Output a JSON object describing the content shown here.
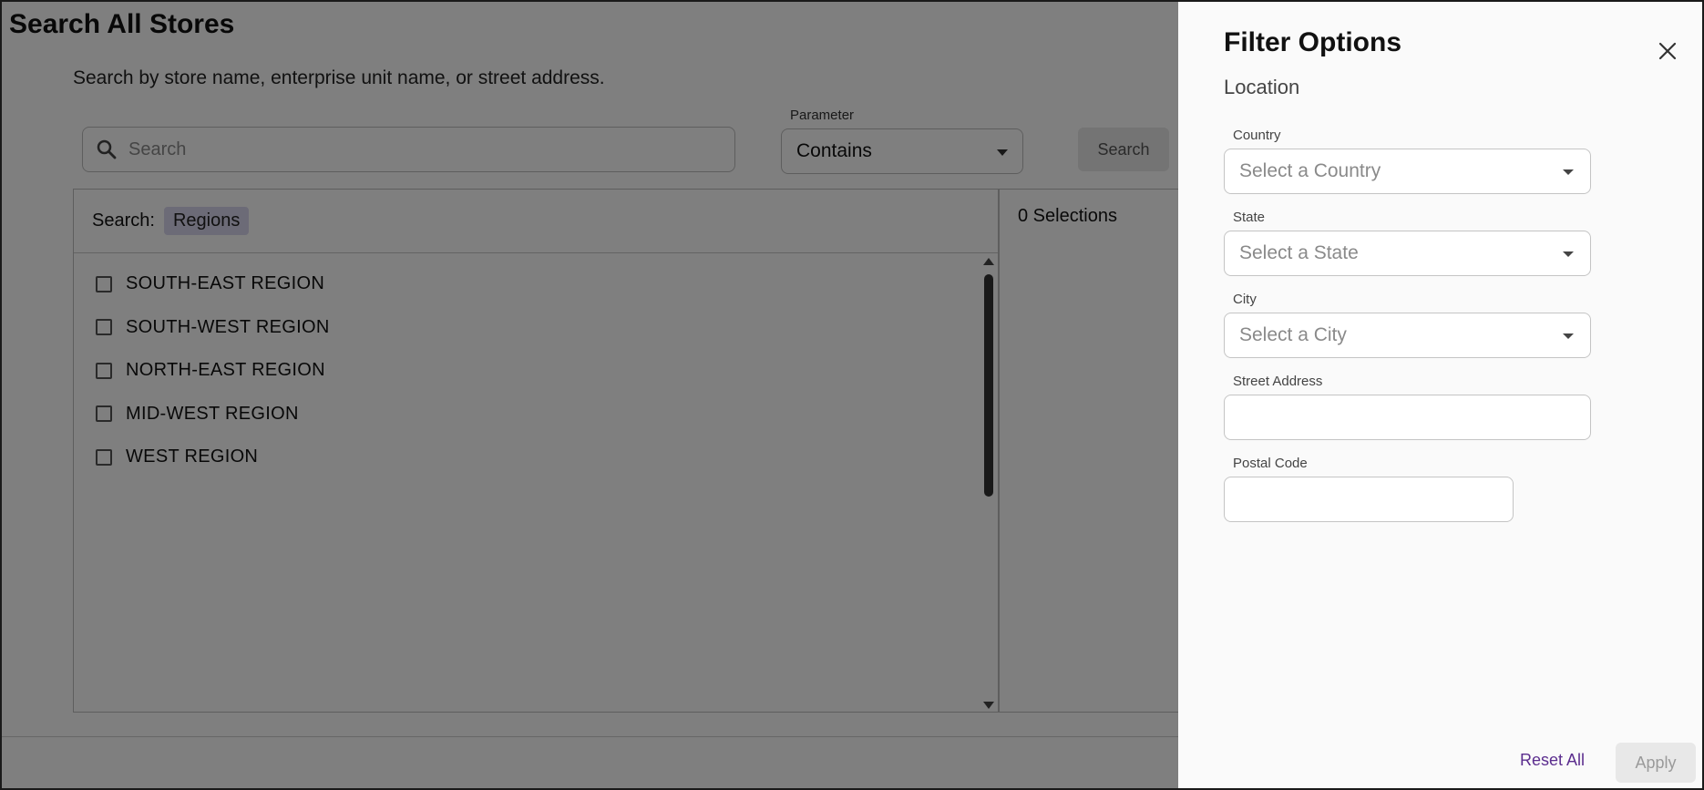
{
  "page": {
    "title": "Search All Stores",
    "subtitle": "Search by store name, enterprise unit name, or street address."
  },
  "search": {
    "placeholder": "Search",
    "parameter_label": "Parameter",
    "parameter_value": "Contains",
    "button_label": "Search"
  },
  "results": {
    "search_label": "Search:",
    "chip_label": "Regions",
    "items": [
      "SOUTH-EAST REGION",
      "SOUTH-WEST REGION",
      "NORTH-EAST REGION",
      "MID-WEST REGION",
      "WEST REGION"
    ]
  },
  "selections": {
    "label": "0 Selections"
  },
  "drawer": {
    "title": "Filter Options",
    "section": "Location",
    "country_label": "Country",
    "country_placeholder": "Select a Country",
    "state_label": "State",
    "state_placeholder": "Select a State",
    "city_label": "City",
    "city_placeholder": "Select a City",
    "street_label": "Street Address",
    "street_value": "",
    "postal_label": "Postal Code",
    "postal_value": "",
    "reset_label": "Reset All",
    "apply_label": "Apply"
  },
  "colors": {
    "overlay": "#000000",
    "chip": "#d9d6ee",
    "reset_link": "#5b2d8e"
  }
}
